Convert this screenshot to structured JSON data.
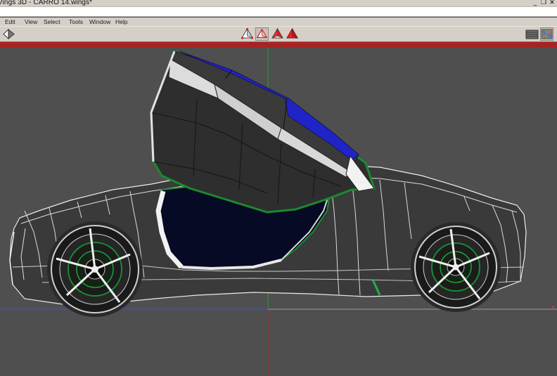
{
  "window": {
    "title": "Vings 3D - CARRO 14.wings*",
    "controls": [
      "_",
      "❐",
      "✕"
    ]
  },
  "menu": {
    "items": [
      "Edit",
      "View",
      "Select",
      "Tools",
      "Window",
      "Help"
    ]
  },
  "toolbar": {
    "left_tool": "selection-cursor-icon",
    "modes": [
      "vertex-mode-icon",
      "edge-mode-icon",
      "face-mode-icon",
      "body-mode-icon"
    ],
    "active_mode": "edge-mode-icon",
    "right_tools": [
      "groundplane-icon",
      "axes-toggle-icon"
    ]
  },
  "colors": {
    "viewport_bg": "#4f4f4f",
    "selection_blue": "#1f23c8",
    "edge_green": "#138c2a",
    "title_red": "#a52524",
    "x_axis": "#ff3a3a",
    "y_axis": "#22cc44",
    "z_axis": "#3a4cff"
  }
}
